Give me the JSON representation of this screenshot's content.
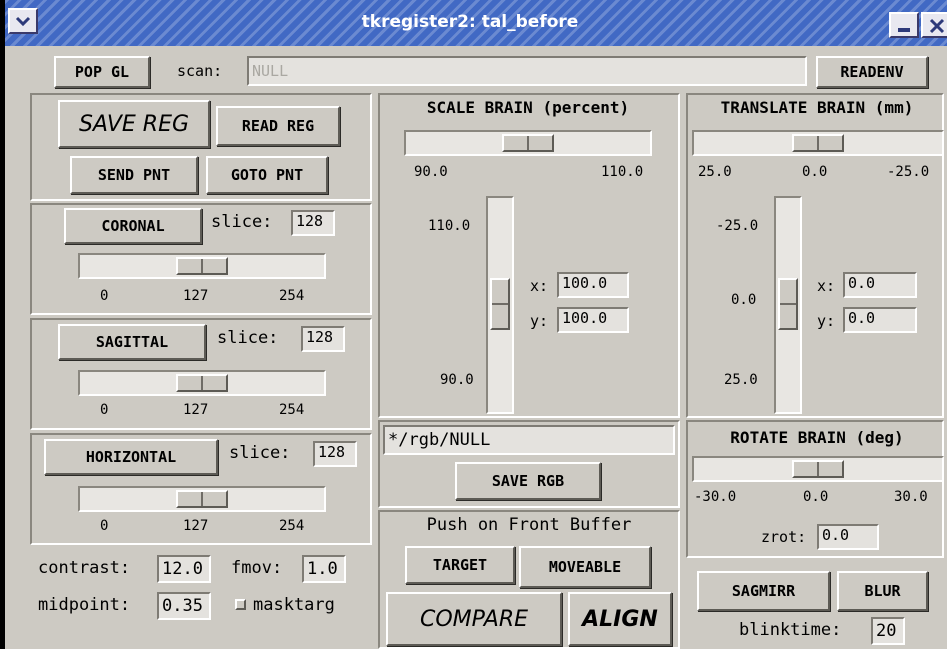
{
  "window": {
    "title": "tkregister2: tal_before",
    "menu_icon": "chevron-down-icon",
    "minimize_icon": "minimize-icon",
    "close_icon": "close-icon"
  },
  "topbar": {
    "pop_gl": "POP GL",
    "scan_label": "scan:",
    "scan_value": "NULL",
    "readenv": "READENV"
  },
  "reg": {
    "save_reg": "SAVE REG",
    "read_reg": "READ REG",
    "send_pnt": "SEND PNT",
    "goto_pnt": "GOTO PNT"
  },
  "views": [
    {
      "button": "CORONAL",
      "slice_label": "slice:",
      "slice_value": "128",
      "min": "0",
      "mid": "127",
      "max": "254",
      "slider_fraction": 0.5
    },
    {
      "button": "SAGITTAL",
      "slice_label": "slice:",
      "slice_value": "128",
      "min": "0",
      "mid": "127",
      "max": "254",
      "slider_fraction": 0.5
    },
    {
      "button": "HORIZONTAL",
      "slice_label": "slice:",
      "slice_value": "128",
      "min": "0",
      "mid": "127",
      "max": "254",
      "slider_fraction": 0.5
    }
  ],
  "contrast": {
    "contrast_label": "contrast:",
    "contrast_value": "12.0",
    "fmov_label": "fmov:",
    "fmov_value": "1.0",
    "midpoint_label": "midpoint:",
    "midpoint_value": "0.35",
    "masktarg_label": "masktarg",
    "masktarg_checked": false
  },
  "scale": {
    "title": "SCALE BRAIN (percent)",
    "h_min": "90.0",
    "h_max": "110.0",
    "v_top": "110.0",
    "v_bottom": "90.0",
    "x_label": "x:",
    "x_value": "100.0",
    "y_label": "y:",
    "y_value": "100.0"
  },
  "translate": {
    "title": "TRANSLATE BRAIN (mm)",
    "h_left": "25.0",
    "h_mid": "0.0",
    "h_right": "-25.0",
    "v_top": "-25.0",
    "v_mid": "0.0",
    "v_bottom": "25.0",
    "x_label": "x:",
    "x_value": "0.0",
    "y_label": "y:",
    "y_value": "0.0"
  },
  "rgb": {
    "path_value": "*/rgb/NULL",
    "save_rgb": "SAVE RGB"
  },
  "buffer": {
    "label": "Push on Front Buffer",
    "target": "TARGET",
    "moveable": "MOVEABLE",
    "compare": "COMPARE",
    "align": "ALIGN"
  },
  "rotate": {
    "title": "ROTATE BRAIN (deg)",
    "min": "-30.0",
    "mid": "0.0",
    "max": "30.0",
    "zrot_label": "zrot:",
    "zrot_value": "0.0"
  },
  "bottom_right": {
    "sagmirr": "SAGMIRR",
    "blur": "BLUR",
    "blinktime_label": "blinktime:",
    "blinktime_value": "20"
  }
}
